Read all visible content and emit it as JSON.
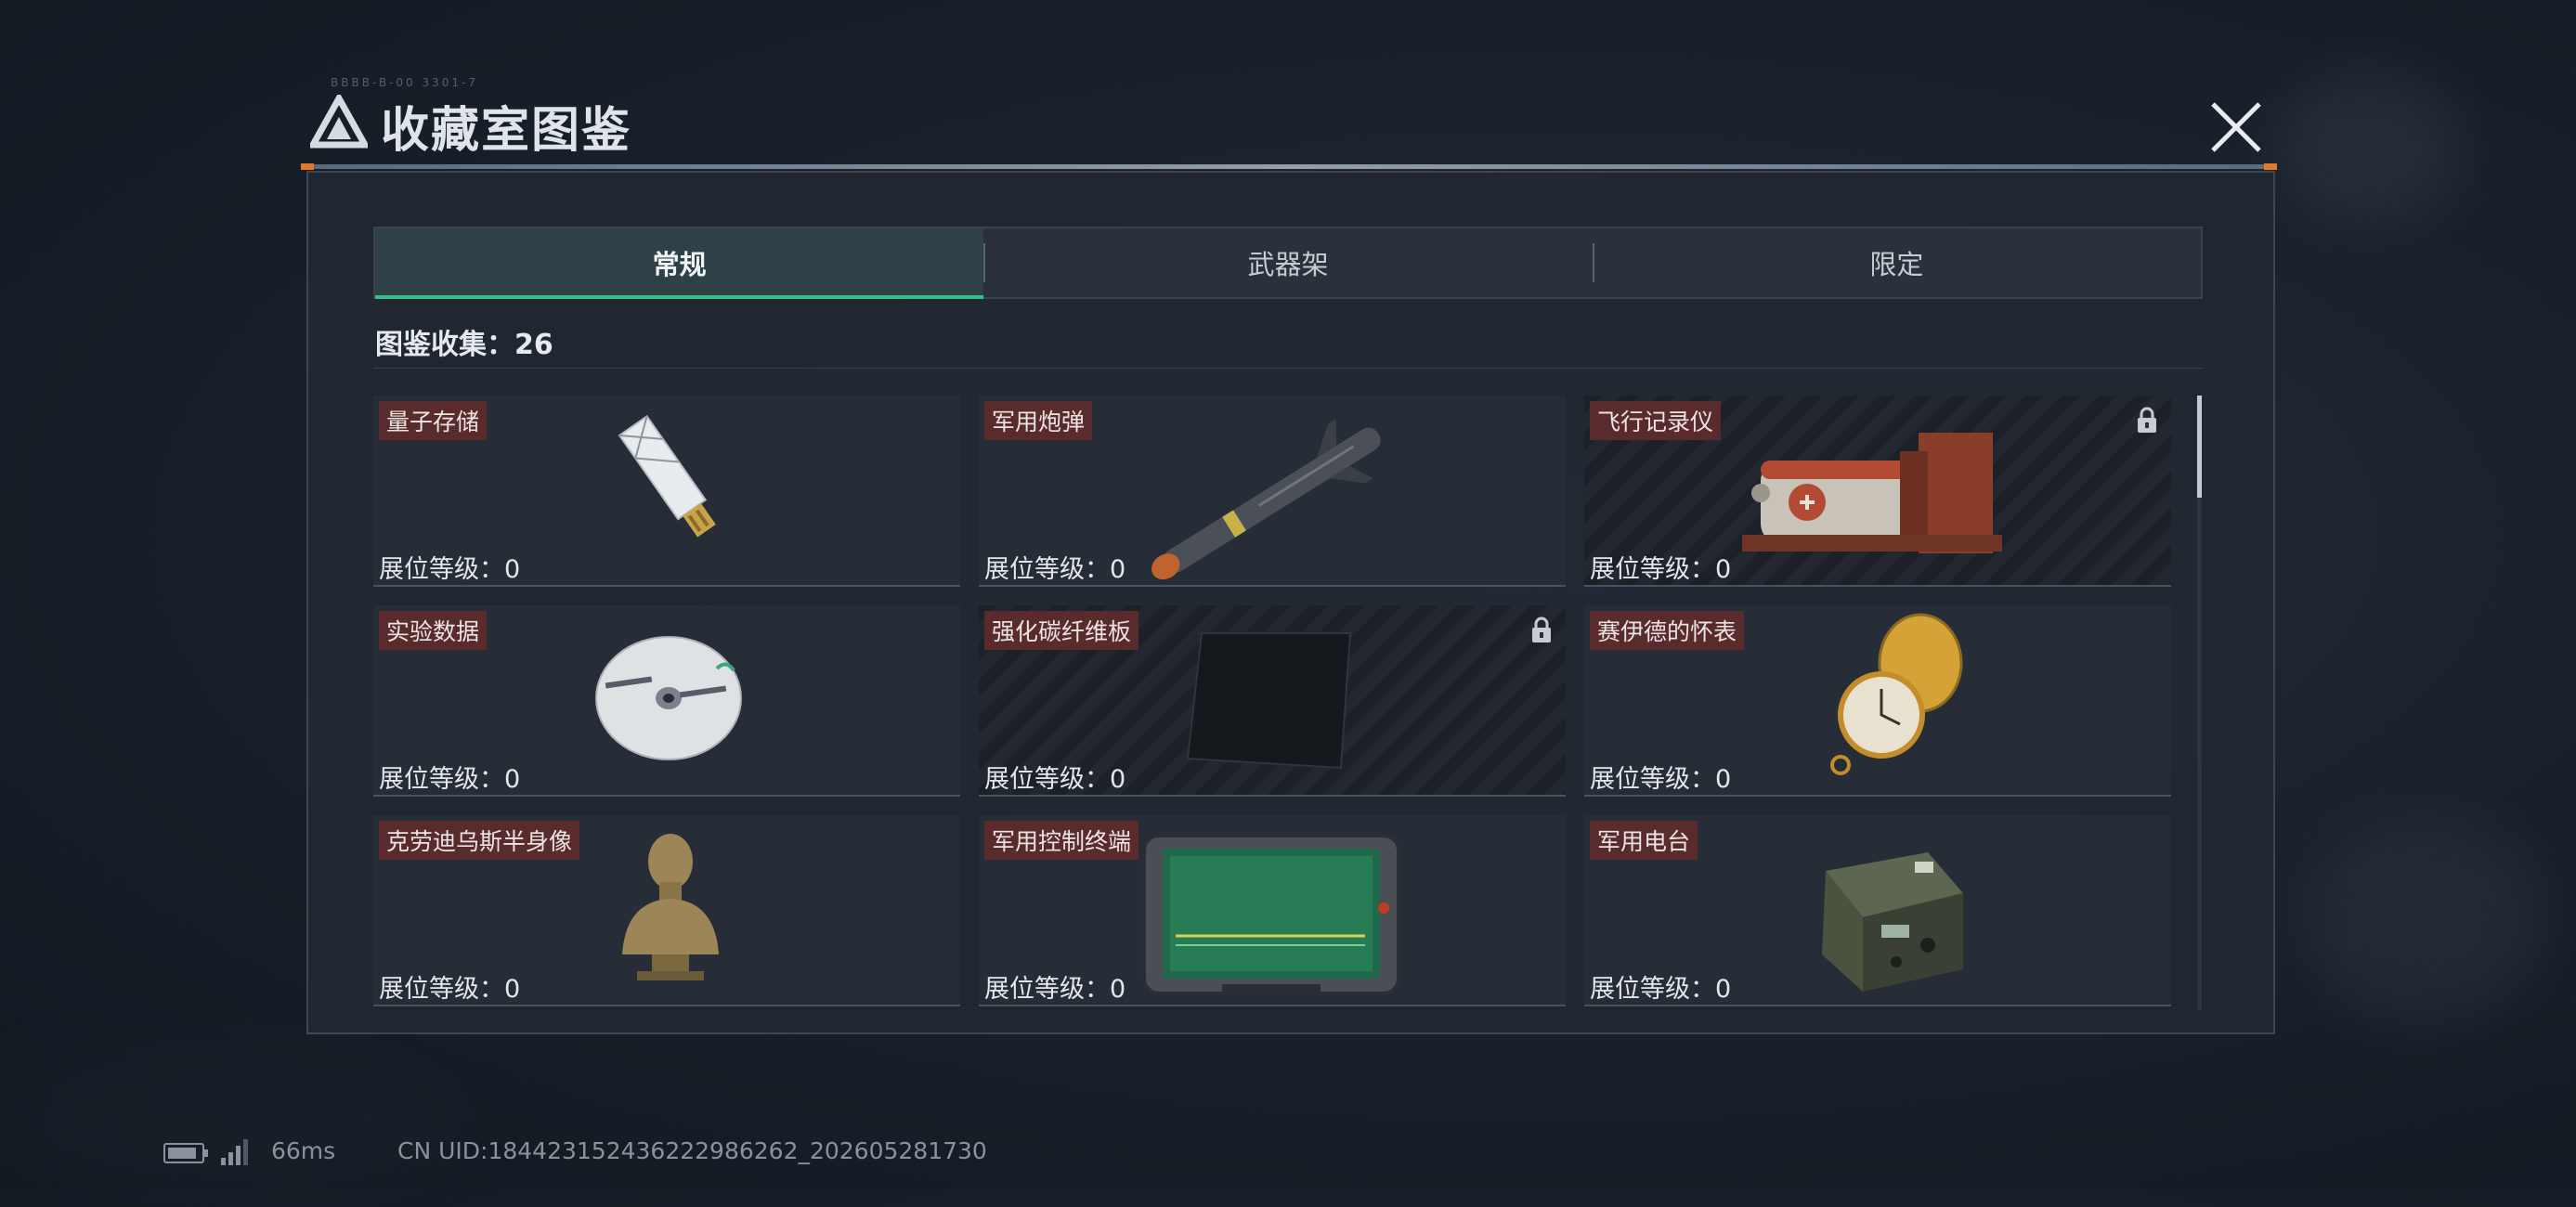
{
  "header": {
    "title": "收藏室图鉴",
    "deco": "BBBB-B-00 3301-7"
  },
  "tabs": [
    {
      "label": "常规",
      "active": true
    },
    {
      "label": "武器架",
      "active": false
    },
    {
      "label": "限定",
      "active": false
    }
  ],
  "collection": {
    "text": "图鉴收集：26"
  },
  "items": [
    {
      "name": "量子存储",
      "level": "展位等级：0",
      "locked": false,
      "icon": "usb-drive-icon"
    },
    {
      "name": "军用炮弹",
      "level": "展位等级：0",
      "locked": false,
      "icon": "missile-icon"
    },
    {
      "name": "飞行记录仪",
      "level": "展位等级：0",
      "locked": true,
      "icon": "flight-recorder-icon"
    },
    {
      "name": "实验数据",
      "level": "展位等级：0",
      "locked": false,
      "icon": "disc-icon"
    },
    {
      "name": "强化碳纤维板",
      "level": "展位等级：0",
      "locked": true,
      "icon": "carbon-plate-icon"
    },
    {
      "name": "赛伊德的怀表",
      "level": "展位等级：0",
      "locked": false,
      "icon": "pocket-watch-icon"
    },
    {
      "name": "克劳迪乌斯半身像",
      "level": "展位等级：0",
      "locked": false,
      "icon": "bust-icon"
    },
    {
      "name": "军用控制终端",
      "level": "展位等级：0",
      "locked": false,
      "icon": "control-terminal-icon"
    },
    {
      "name": "军用电台",
      "level": "展位等级：0",
      "locked": false,
      "icon": "radio-icon"
    }
  ],
  "footer": {
    "ping": "66ms",
    "uid": "CN UID:1844231524362229862​62_202605281730"
  },
  "colors": {
    "accent": "#31c28a",
    "name_tag": "#5a2b2c",
    "panel": "#222832"
  }
}
